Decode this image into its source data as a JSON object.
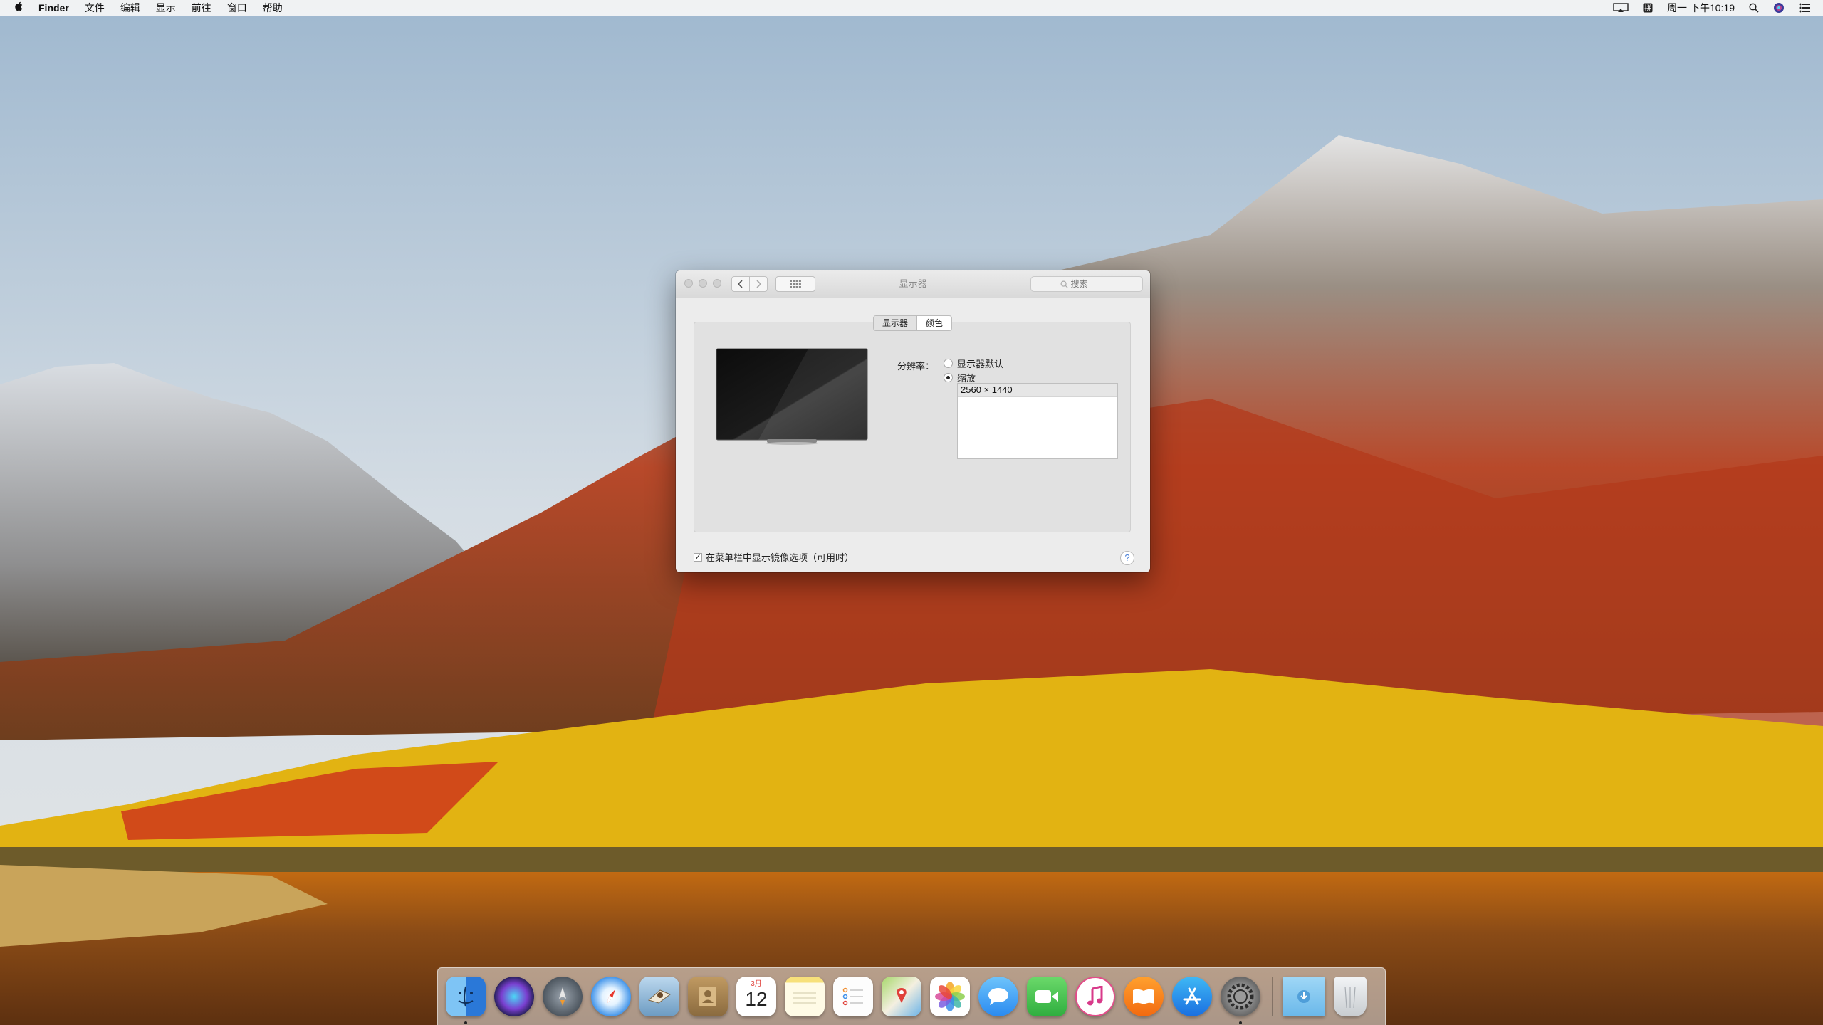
{
  "menubar": {
    "apple_icon": "apple-logo-icon",
    "items": [
      "Finder",
      "文件",
      "编辑",
      "显示",
      "前往",
      "窗口",
      "帮助"
    ],
    "status": {
      "airplay_icon": "airplay-icon",
      "input_method_icon": "input-method-icon",
      "clock": "周一 下午10:19",
      "spotlight_icon": "spotlight-search-icon",
      "siri_icon": "siri-icon",
      "notification_icon": "notification-center-icon"
    }
  },
  "window": {
    "title": "显示器",
    "search_placeholder": "搜索",
    "tabs": [
      "显示器",
      "颜色"
    ],
    "active_tab": "显示器",
    "resolution_label": "分辨率：",
    "options": [
      {
        "label": "显示器默认",
        "selected": false
      },
      {
        "label": "缩放",
        "selected": true
      }
    ],
    "resolutions": [
      "2560 × 1440"
    ],
    "mirror_checkbox": {
      "label": "在菜单栏中显示镜像选项（可用时）",
      "checked": true
    },
    "help": "?"
  },
  "dock": {
    "apps": [
      {
        "name": "Finder",
        "icon": "finder-icon",
        "running": true
      },
      {
        "name": "Siri",
        "icon": "siri-icon",
        "running": false
      },
      {
        "name": "Launchpad",
        "icon": "launchpad-icon",
        "running": false
      },
      {
        "name": "Safari",
        "icon": "safari-icon",
        "running": false
      },
      {
        "name": "Mail",
        "icon": "mail-icon",
        "running": false
      },
      {
        "name": "Contacts",
        "icon": "contacts-icon",
        "running": false
      },
      {
        "name": "Calendar",
        "icon": "calendar-icon",
        "running": false,
        "month": "3月",
        "day": "12"
      },
      {
        "name": "Notes",
        "icon": "notes-icon",
        "running": false
      },
      {
        "name": "Reminders",
        "icon": "reminders-icon",
        "running": false
      },
      {
        "name": "Maps",
        "icon": "maps-icon",
        "running": false
      },
      {
        "name": "Photos",
        "icon": "photos-icon",
        "running": false
      },
      {
        "name": "Messages",
        "icon": "messages-icon",
        "running": false
      },
      {
        "name": "FaceTime",
        "icon": "facetime-icon",
        "running": false
      },
      {
        "name": "iTunes",
        "icon": "itunes-icon",
        "running": false
      },
      {
        "name": "iBooks",
        "icon": "ibooks-icon",
        "running": false
      },
      {
        "name": "App Store",
        "icon": "app-store-icon",
        "running": false
      },
      {
        "name": "System Preferences",
        "icon": "system-preferences-icon",
        "running": true
      }
    ],
    "downloads_icon": "downloads-folder-icon",
    "trash_icon": "trash-icon"
  },
  "colors": {
    "menubar_bg": "#f6f6f6",
    "window_bg": "#ececec",
    "accent": "#4a7fd6"
  }
}
